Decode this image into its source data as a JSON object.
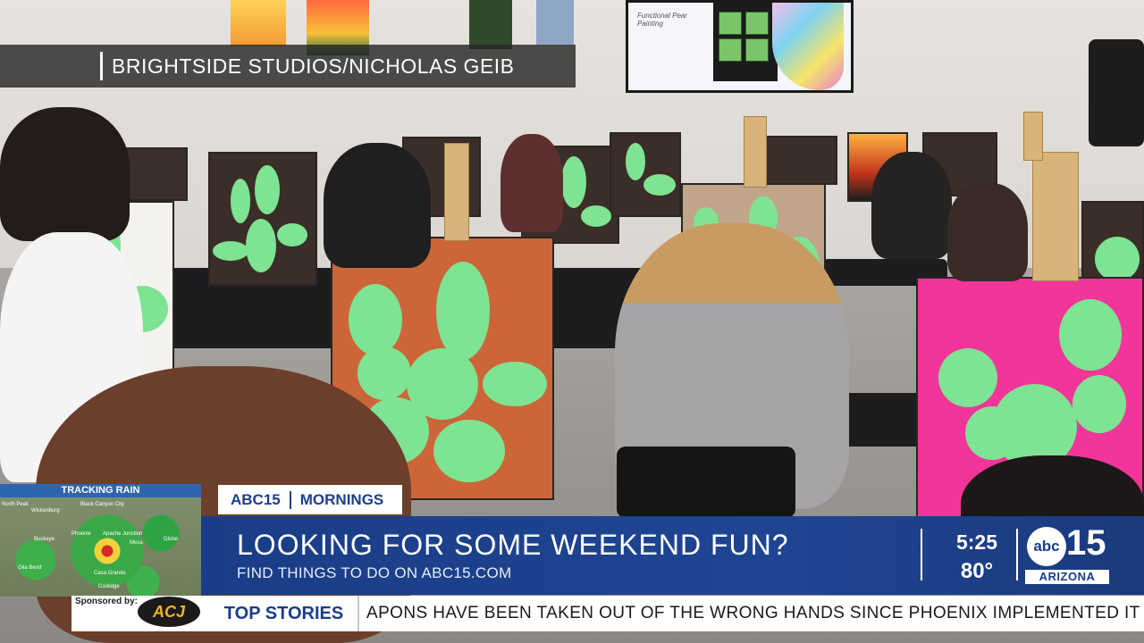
{
  "credit": {
    "text": "BRIGHTSIDE STUDIOS/NICHOLAS GEIB"
  },
  "radar": {
    "title": "TRACKING RAIN",
    "cities": [
      "North Peak",
      "Black Canyon City",
      "Wickenburg",
      "Apache Junction",
      "Buckeye",
      "Phoenix",
      "Mesa",
      "Globe",
      "Gila Bend",
      "Casa Grande",
      "Coolidge"
    ]
  },
  "brand": {
    "station": "ABC15",
    "show": "MORNINGS"
  },
  "lower_third": {
    "headline": "LOOKING FOR SOME WEEKEND FUN?",
    "subline": "FIND THINGS TO DO ON ABC15.COM",
    "time": "5:25",
    "temperature": "80°"
  },
  "logo": {
    "mark": "abc",
    "number": "15",
    "state": "ARIZONA"
  },
  "ticker": {
    "sponsor_label": "Sponsored by:",
    "sponsor_logo": "ACJ",
    "section_label": "TOP STORIES",
    "crawl_text": "APONS HAVE BEEN TAKEN OUT OF THE WRONG HANDS SINCE PHOENIX IMPLEMENTED IT"
  },
  "screen": {
    "caption": "Functional Pear Painting"
  },
  "colors": {
    "brand_blue": "#1a3d86",
    "lower_third_bg": "#1f4592",
    "ticker_bg": "#ffffff",
    "cactus_green": "#7ee392"
  }
}
